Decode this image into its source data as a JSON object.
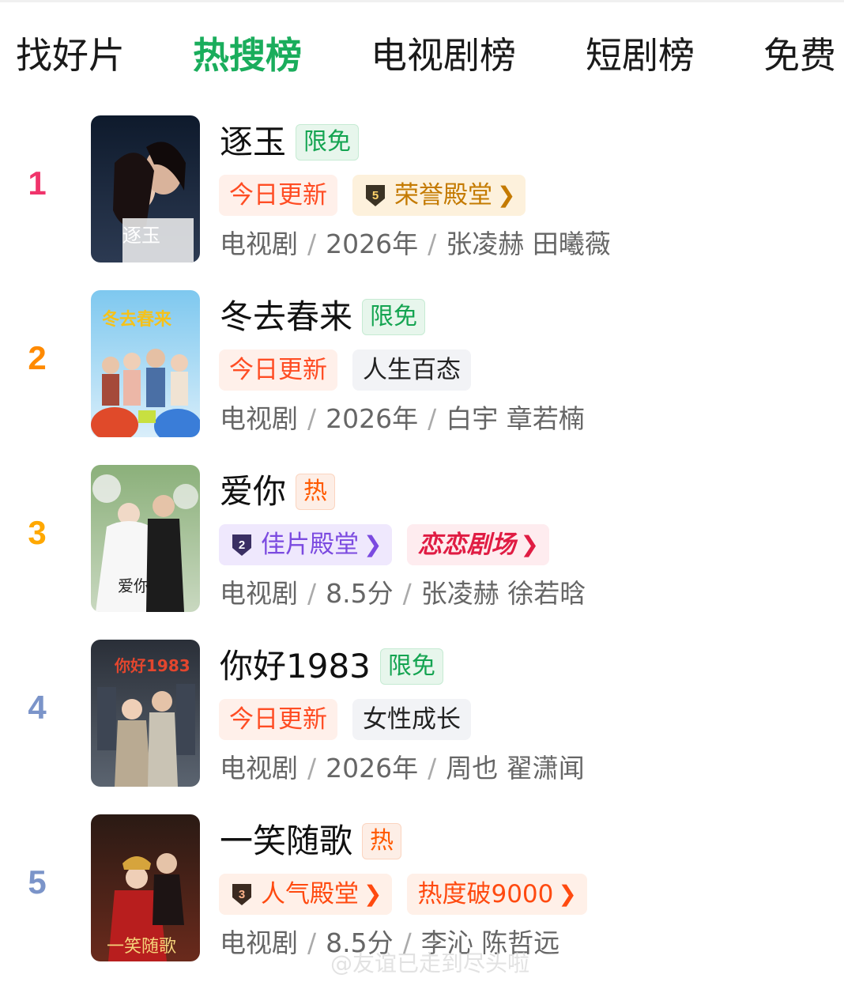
{
  "tabs": [
    "找好片",
    "热搜榜",
    "电视剧榜",
    "短剧榜",
    "免费"
  ],
  "active_tab": 1,
  "colors": {
    "active_tab": "#1aad5c",
    "rank_1": "#f0346b",
    "rank_2": "#ff8a00",
    "rank_3": "#ffa800",
    "rank_4": "#7b94c9",
    "rank_5": "#7b94c9"
  },
  "items": [
    {
      "rank": "1",
      "title": "逐玉",
      "badge": "限免",
      "tags": [
        "今日更新",
        "荣誉殿堂"
      ],
      "meta": {
        "type": "电视剧",
        "info": "2026年",
        "cast": "张凌赫 田曦薇"
      }
    },
    {
      "rank": "2",
      "title": "冬去春来",
      "badge": "限免",
      "tags": [
        "今日更新",
        "人生百态"
      ],
      "meta": {
        "type": "电视剧",
        "info": "2026年",
        "cast": "白宇 章若楠"
      }
    },
    {
      "rank": "3",
      "title": "爱你",
      "badge": "热",
      "tags": [
        "佳片殿堂",
        "恋恋剧场"
      ],
      "meta": {
        "type": "电视剧",
        "info": "8.5分",
        "cast": "张凌赫 徐若晗"
      }
    },
    {
      "rank": "4",
      "title": "你好1983",
      "badge": "限免",
      "tags": [
        "今日更新",
        "女性成长"
      ],
      "meta": {
        "type": "电视剧",
        "info": "2026年",
        "cast": "周也 翟潇闻"
      }
    },
    {
      "rank": "5",
      "title": "一笑随歌",
      "badge": "热",
      "tags": [
        "人气殿堂",
        "热度破9000"
      ],
      "meta": {
        "type": "电视剧",
        "info": "8.5分",
        "cast": "李沁 陈哲远"
      }
    }
  ],
  "medals": {
    "gold": "5",
    "purple": "2",
    "orange": "3"
  },
  "watermark": "@友谊已走到尽头啦"
}
